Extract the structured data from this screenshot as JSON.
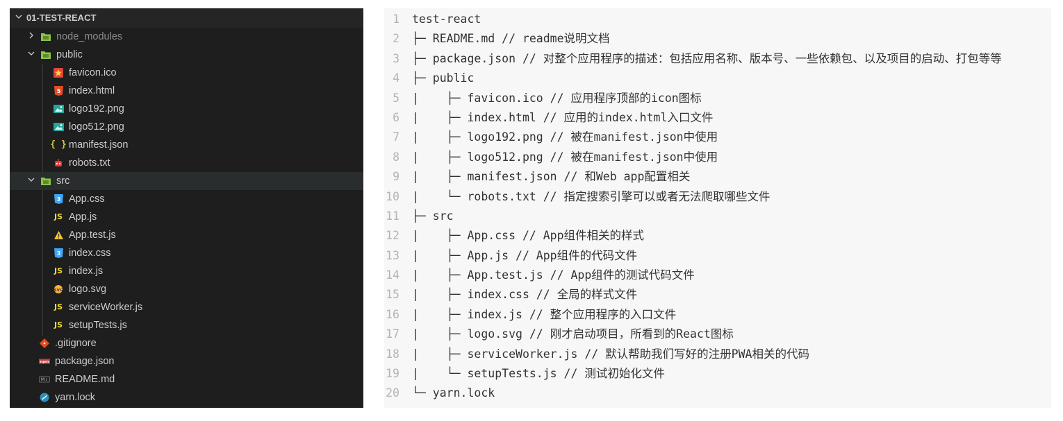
{
  "explorer": {
    "title": "01-TEST-REACT",
    "items": [
      {
        "label": "node_modules",
        "depth": 1,
        "kind": "folder-node",
        "chev": ">",
        "muted": true
      },
      {
        "label": "public",
        "depth": 1,
        "kind": "folder-public",
        "chev": "v"
      },
      {
        "label": "favicon.ico",
        "depth": 2,
        "kind": "favicon"
      },
      {
        "label": "index.html",
        "depth": 2,
        "kind": "html"
      },
      {
        "label": "logo192.png",
        "depth": 2,
        "kind": "image"
      },
      {
        "label": "logo512.png",
        "depth": 2,
        "kind": "image"
      },
      {
        "label": "manifest.json",
        "depth": 2,
        "kind": "json"
      },
      {
        "label": "robots.txt",
        "depth": 2,
        "kind": "robot"
      },
      {
        "label": "src",
        "depth": 1,
        "kind": "folder-src",
        "chev": "v",
        "selected": true
      },
      {
        "label": "App.css",
        "depth": 2,
        "kind": "css"
      },
      {
        "label": "App.js",
        "depth": 2,
        "kind": "js"
      },
      {
        "label": "App.test.js",
        "depth": 2,
        "kind": "test"
      },
      {
        "label": "index.css",
        "depth": 2,
        "kind": "css"
      },
      {
        "label": "index.js",
        "depth": 2,
        "kind": "js"
      },
      {
        "label": "logo.svg",
        "depth": 2,
        "kind": "svg"
      },
      {
        "label": "serviceWorker.js",
        "depth": 2,
        "kind": "js"
      },
      {
        "label": "setupTests.js",
        "depth": 2,
        "kind": "js"
      },
      {
        "label": ".gitignore",
        "depth": 1,
        "kind": "git"
      },
      {
        "label": "package.json",
        "depth": 1,
        "kind": "npm"
      },
      {
        "label": "README.md",
        "depth": 1,
        "kind": "md"
      },
      {
        "label": "yarn.lock",
        "depth": 1,
        "kind": "yarn"
      }
    ]
  },
  "code": {
    "lines": [
      "test-react",
      "├─ README.md // readme说明文档",
      "├─ package.json // 对整个应用程序的描述：包括应用名称、版本号、一些依赖包、以及项目的启动、打包等等",
      "├─ public",
      "|    ├─ favicon.ico // 应用程序顶部的icon图标",
      "|    ├─ index.html // 应用的index.html入口文件",
      "|    ├─ logo192.png // 被在manifest.json中使用",
      "|    ├─ logo512.png // 被在manifest.json中使用",
      "|    ├─ manifest.json // 和Web app配置相关",
      "|    └─ robots.txt // 指定搜索引擎可以或者无法爬取哪些文件",
      "├─ src",
      "|    ├─ App.css // App组件相关的样式",
      "|    ├─ App.js // App组件的代码文件",
      "|    ├─ App.test.js // App组件的测试代码文件",
      "|    ├─ index.css // 全局的样式文件",
      "|    ├─ index.js // 整个应用程序的入口文件",
      "|    ├─ logo.svg // 刚才启动项目，所看到的React图标",
      "|    ├─ serviceWorker.js // 默认帮助我们写好的注册PWA相关的代码",
      "|    └─ setupTests.js // 测试初始化文件",
      "└─ yarn.lock"
    ]
  }
}
